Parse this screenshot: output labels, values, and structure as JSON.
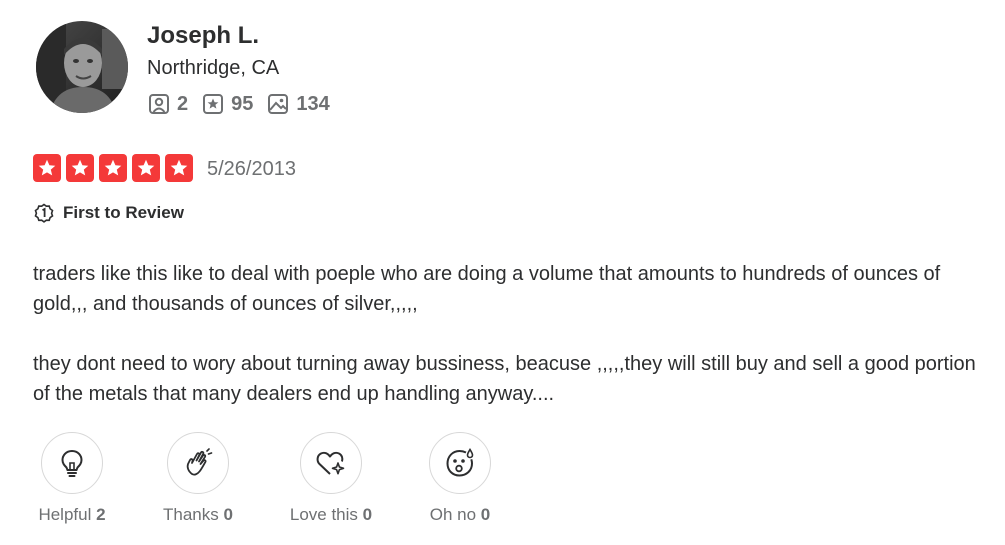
{
  "user": {
    "name": "Joseph L.",
    "location": "Northridge, CA",
    "stats": {
      "friends": "2",
      "reviews": "95",
      "photos": "134"
    }
  },
  "review": {
    "rating": 5,
    "date": "5/26/2013",
    "badge": "First to Review",
    "paragraphs": [
      "traders like this like to deal with poeple who are doing a volume that amounts to hundreds of ounces of gold,,, and thousands of ounces of silver,,,,,",
      "they dont need to wory about turning away bussiness, beacuse ,,,,,they will still buy and sell a good portion of the metals that many dealers end up handling anyway...."
    ]
  },
  "reactions": {
    "helpful": {
      "label": "Helpful",
      "count": "2"
    },
    "thanks": {
      "label": "Thanks",
      "count": "0"
    },
    "love_this": {
      "label": "Love this",
      "count": "0"
    },
    "oh_no": {
      "label": "Oh no",
      "count": "0"
    }
  },
  "colors": {
    "star_red": "#f43939",
    "text": "#2d2e2f",
    "muted": "#6e7072"
  }
}
